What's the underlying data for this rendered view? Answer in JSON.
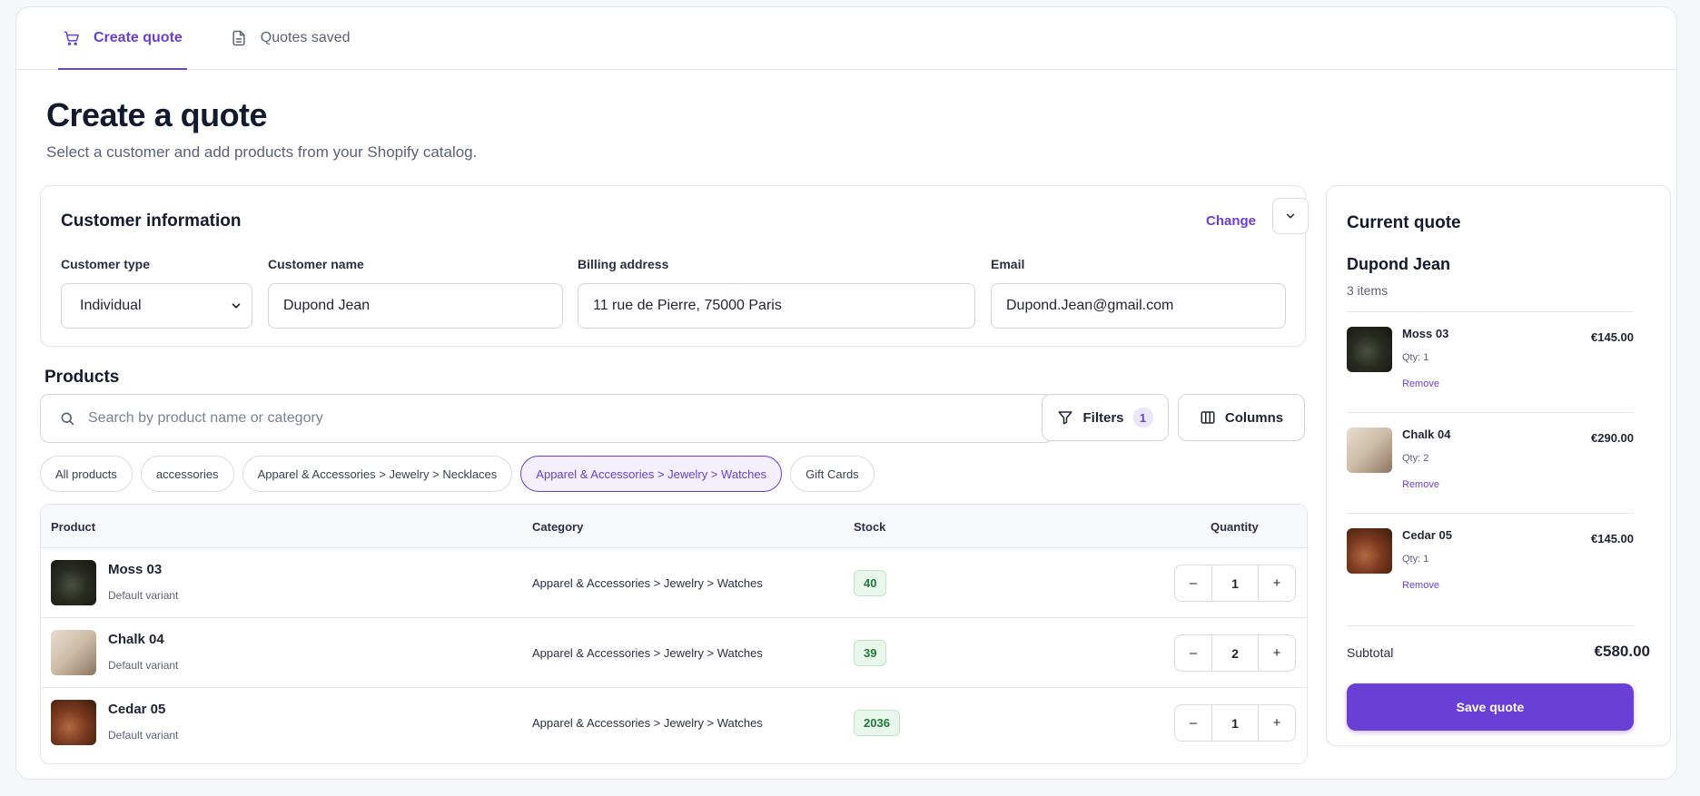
{
  "tabs": [
    {
      "label": "Create quote",
      "icon": "cart-icon",
      "active": true
    },
    {
      "label": "Quotes saved",
      "icon": "document-icon",
      "active": false
    }
  ],
  "page": {
    "title": "Create a quote",
    "subtitle": "Select a customer and add products from your Shopify catalog."
  },
  "customer": {
    "title": "Customer information",
    "change_label": "Change",
    "type_label": "Customer type",
    "type_value": "Individual",
    "name_label": "Customer name",
    "name_value": "Dupond Jean",
    "address_label": "Billing address",
    "address_value": "11 rue de Pierre, 75000 Paris",
    "email_label": "Email",
    "email_value": "Dupond.Jean@gmail.com"
  },
  "products": {
    "title": "Products",
    "search_placeholder": "Search by product name or category",
    "filters_label": "Filters",
    "filters_count": "1",
    "columns_label": "Columns",
    "chips": [
      {
        "label": "All products",
        "active": false
      },
      {
        "label": "accessories",
        "active": false
      },
      {
        "label": "Apparel & Accessories > Jewelry > Necklaces",
        "active": false
      },
      {
        "label": "Apparel & Accessories > Jewelry > Watches",
        "active": true
      },
      {
        "label": "Gift Cards",
        "active": false
      }
    ],
    "columns": {
      "product": "Product",
      "category": "Category",
      "stock": "Stock",
      "quantity": "Quantity"
    },
    "rows": [
      {
        "name": "Moss 03",
        "variant": "Default variant",
        "category": "Apparel & Accessories > Jewelry > Watches",
        "stock": "40",
        "qty": "1"
      },
      {
        "name": "Chalk 04",
        "variant": "Default variant",
        "category": "Apparel & Accessories > Jewelry > Watches",
        "stock": "39",
        "qty": "2"
      },
      {
        "name": "Cedar 05",
        "variant": "Default variant",
        "category": "Apparel & Accessories > Jewelry > Watches",
        "stock": "2036",
        "qty": "1"
      }
    ],
    "minus": "–",
    "plus": "+"
  },
  "quote": {
    "title": "Current quote",
    "customer": "Dupond Jean",
    "count": "3 items",
    "items": [
      {
        "name": "Moss 03",
        "qty": "Qty: 1",
        "price": "€145.00",
        "remove": "Remove"
      },
      {
        "name": "Chalk 04",
        "qty": "Qty: 2",
        "price": "€290.00",
        "remove": "Remove"
      },
      {
        "name": "Cedar 05",
        "qty": "Qty: 1",
        "price": "€145.00",
        "remove": "Remove"
      }
    ],
    "subtotal_label": "Subtotal",
    "subtotal_value": "€580.00",
    "save_label": "Save quote"
  },
  "colors": {
    "accent": "#6a3fd6",
    "stock_bg": "#e8f6ec",
    "stock_text": "#1f7a3a"
  }
}
